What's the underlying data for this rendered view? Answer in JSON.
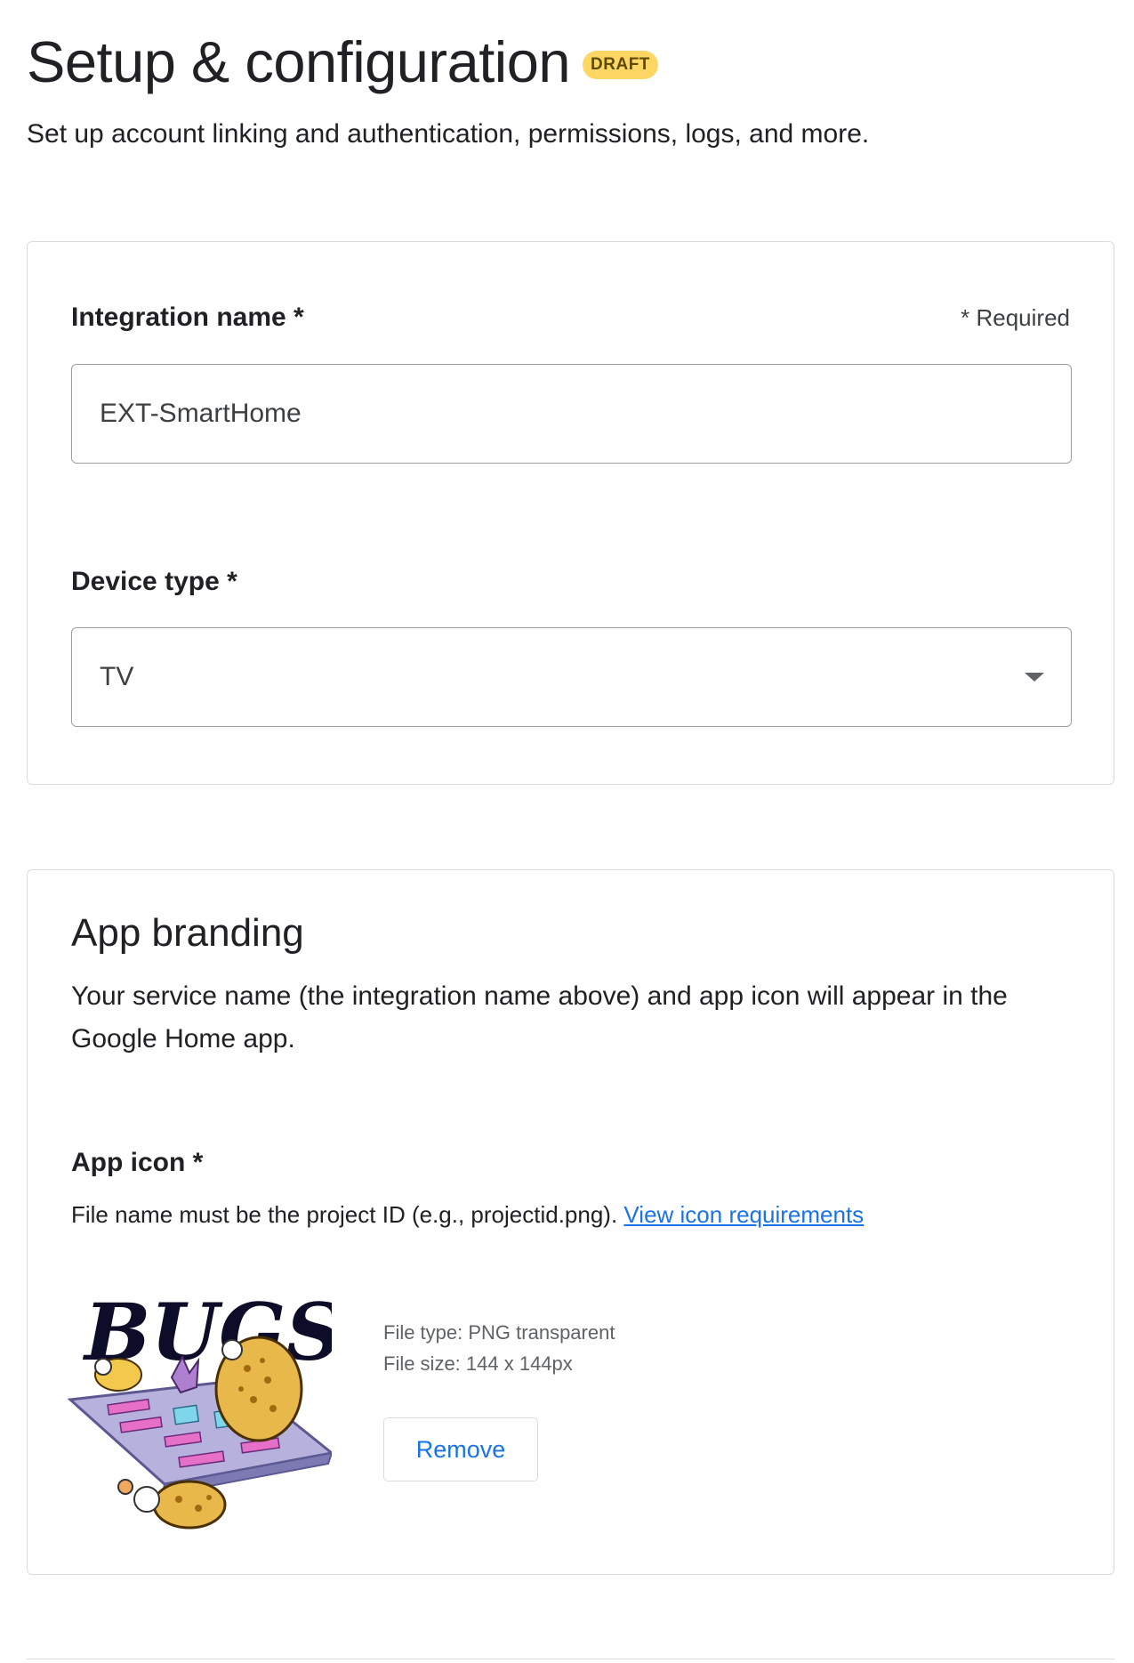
{
  "header": {
    "title": "Setup & configuration",
    "badge": "DRAFT",
    "subtitle": "Set up account linking and authentication, permissions, logs, and more."
  },
  "basic_info": {
    "integration_name_label": "Integration name *",
    "required_note": "* Required",
    "integration_name_value": "EXT-SmartHome",
    "device_type_label": "Device type *",
    "device_type_value": "TV"
  },
  "app_branding": {
    "title": "App branding",
    "description": "Your service name (the integration name above) and app icon will appear in the Google Home app.",
    "app_icon_label": "App icon *",
    "app_icon_help": "File name must be the project ID (e.g., projectid.png).",
    "view_requirements_link": "View icon requirements",
    "icon_logo_text": "BUGS",
    "file_type": "File type: PNG transparent",
    "file_size": "File size: 144 x 144px",
    "remove_label": "Remove"
  },
  "colors": {
    "badge_bg": "#fdd663",
    "link": "#1a73e8",
    "border": "#dadce0"
  }
}
